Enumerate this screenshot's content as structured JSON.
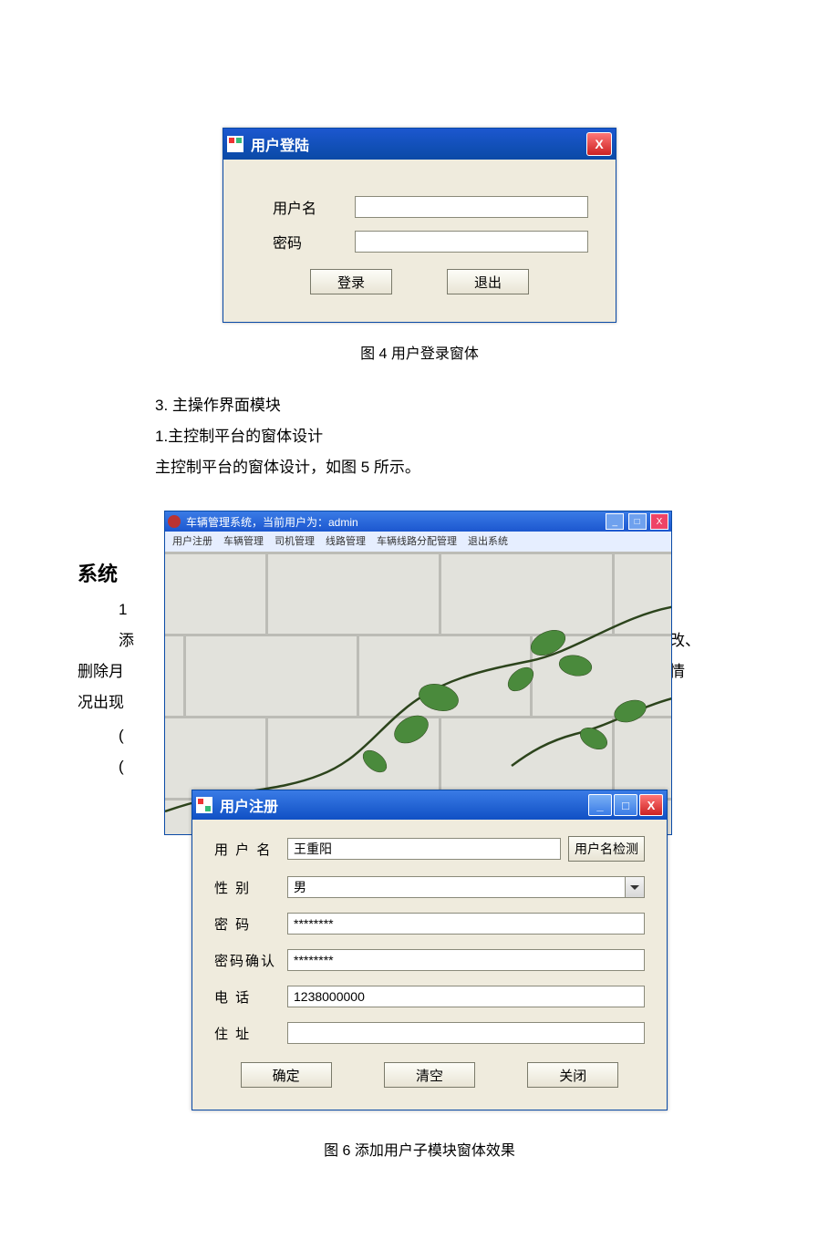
{
  "login": {
    "title": "用户登陆",
    "labels": {
      "user": "用户名",
      "pass": "密码"
    },
    "buttons": {
      "login": "登录",
      "exit": "退出"
    },
    "close_x": "X"
  },
  "fig4_caption": "图 4   用户登录窗体",
  "text": {
    "t1": "3.  主操作界面模块",
    "t2": "1.主控制平台的窗体设计",
    "t3": "主控制平台的窗体设计，如图 5 所示。",
    "bg1": "系统",
    "bg2a": "1",
    "bg3a": "添",
    "bg3b": "能修改、",
    "bg4a": "删除月",
    "bg4b": "除等情",
    "bg5a": "况出现",
    "bg6": "(",
    "bg7": "("
  },
  "mainwin": {
    "title": "车辆管理系统，当前用户为：admin",
    "menu": [
      "用户注册",
      "车辆管理",
      "司机管理",
      "线路管理",
      "车辆线路分配管理",
      "退出系统"
    ],
    "min": "_",
    "max": "□",
    "close": "X"
  },
  "regwin": {
    "title": "用户注册",
    "labels": {
      "name": "用 户 名",
      "sex": "性    别",
      "pass": "密   码",
      "pass2": "密码确认",
      "tel": "电   话",
      "addr": "住   址"
    },
    "values": {
      "name": "王重阳",
      "sex": "男",
      "pass": "********",
      "pass2": "********",
      "tel": "1238000000",
      "addr": ""
    },
    "buttons": {
      "check": "用户名检测",
      "ok": "确定",
      "clear": "清空",
      "close": "关闭"
    },
    "min": "_",
    "max": "□",
    "cls": "X"
  },
  "fig6_caption": "图 6 添加用户子模块窗体效果"
}
